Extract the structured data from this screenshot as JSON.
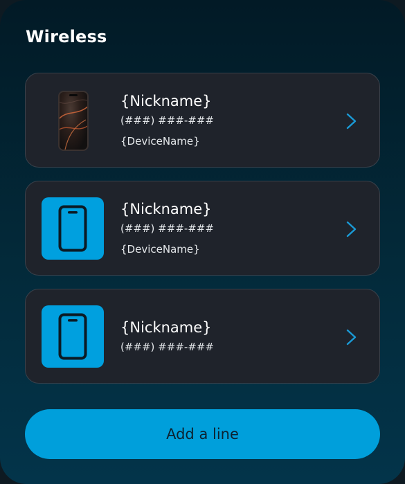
{
  "section": {
    "title": "Wireless"
  },
  "lines": [
    {
      "nickname": "{Nickname}",
      "phone": "(###) ###-###",
      "device": "{DeviceName}",
      "thumbnail": "phone-photo"
    },
    {
      "nickname": "{Nickname}",
      "phone": "(###) ###-###",
      "device": "{DeviceName}",
      "thumbnail": "smartphone-icon"
    },
    {
      "nickname": "{Nickname}",
      "phone": "(###) ###-###",
      "thumbnail": "smartphone-icon"
    }
  ],
  "actions": {
    "add_line_label": "Add a line"
  },
  "colors": {
    "accent": "#009fdb",
    "card_background": "#1f232b",
    "chevron": "#1a9ad6"
  },
  "icons": {
    "row_action": "chevron-right-icon",
    "device_placeholder": "smartphone-icon"
  }
}
